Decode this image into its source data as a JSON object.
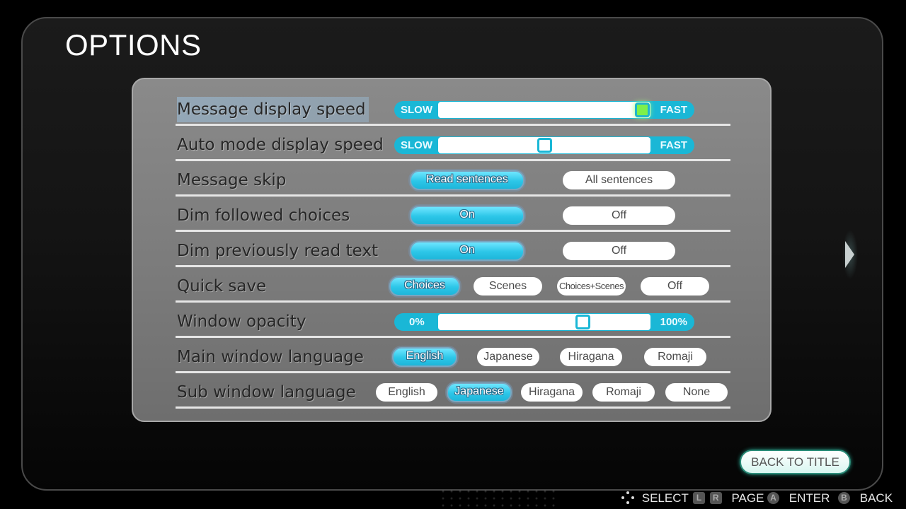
{
  "title": "OPTIONS",
  "colors": {
    "accent": "#1ab7d6",
    "selected_pill": "#2cc6e8",
    "active_knob": "#7ef04a",
    "panel": "#7a7a7a"
  },
  "options": {
    "message_speed": {
      "label": "Message display speed",
      "min_label": "SLOW",
      "max_label": "FAST",
      "value_fraction": 0.96,
      "focused": true
    },
    "auto_speed": {
      "label": "Auto mode display speed",
      "min_label": "SLOW",
      "max_label": "FAST",
      "value_fraction": 0.5
    },
    "message_skip": {
      "label": "Message skip",
      "choices": [
        "Read sentences",
        "All sentences"
      ],
      "selected": "Read sentences"
    },
    "dim_choices": {
      "label": "Dim followed choices",
      "choices": [
        "On",
        "Off"
      ],
      "selected": "On"
    },
    "dim_read_text": {
      "label": "Dim previously read text",
      "choices": [
        "On",
        "Off"
      ],
      "selected": "On"
    },
    "quick_save": {
      "label": "Quick save",
      "choices": [
        "Choices",
        "Scenes",
        "Choices+Scenes",
        "Off"
      ],
      "selected": "Choices"
    },
    "window_opacity": {
      "label": "Window opacity",
      "min_label": "0%",
      "max_label": "100%",
      "value_fraction": 0.68
    },
    "main_language": {
      "label": "Main window language",
      "choices": [
        "English",
        "Japanese",
        "Hiragana",
        "Romaji"
      ],
      "selected": "English"
    },
    "sub_language": {
      "label": "Sub window language",
      "choices": [
        "English",
        "Japanese",
        "Hiragana",
        "Romaji",
        "None"
      ],
      "selected": "Japanese"
    }
  },
  "back_to_title": "BACK TO TITLE",
  "next_page_icon": "chevron-right-icon",
  "hints": {
    "select": {
      "icon": "dpad-icon",
      "label": "SELECT"
    },
    "page": {
      "icons": [
        "L",
        "R"
      ],
      "label": "PAGE"
    },
    "enter": {
      "icon": "A",
      "label": "ENTER"
    },
    "back": {
      "icon": "B",
      "label": "BACK"
    }
  }
}
